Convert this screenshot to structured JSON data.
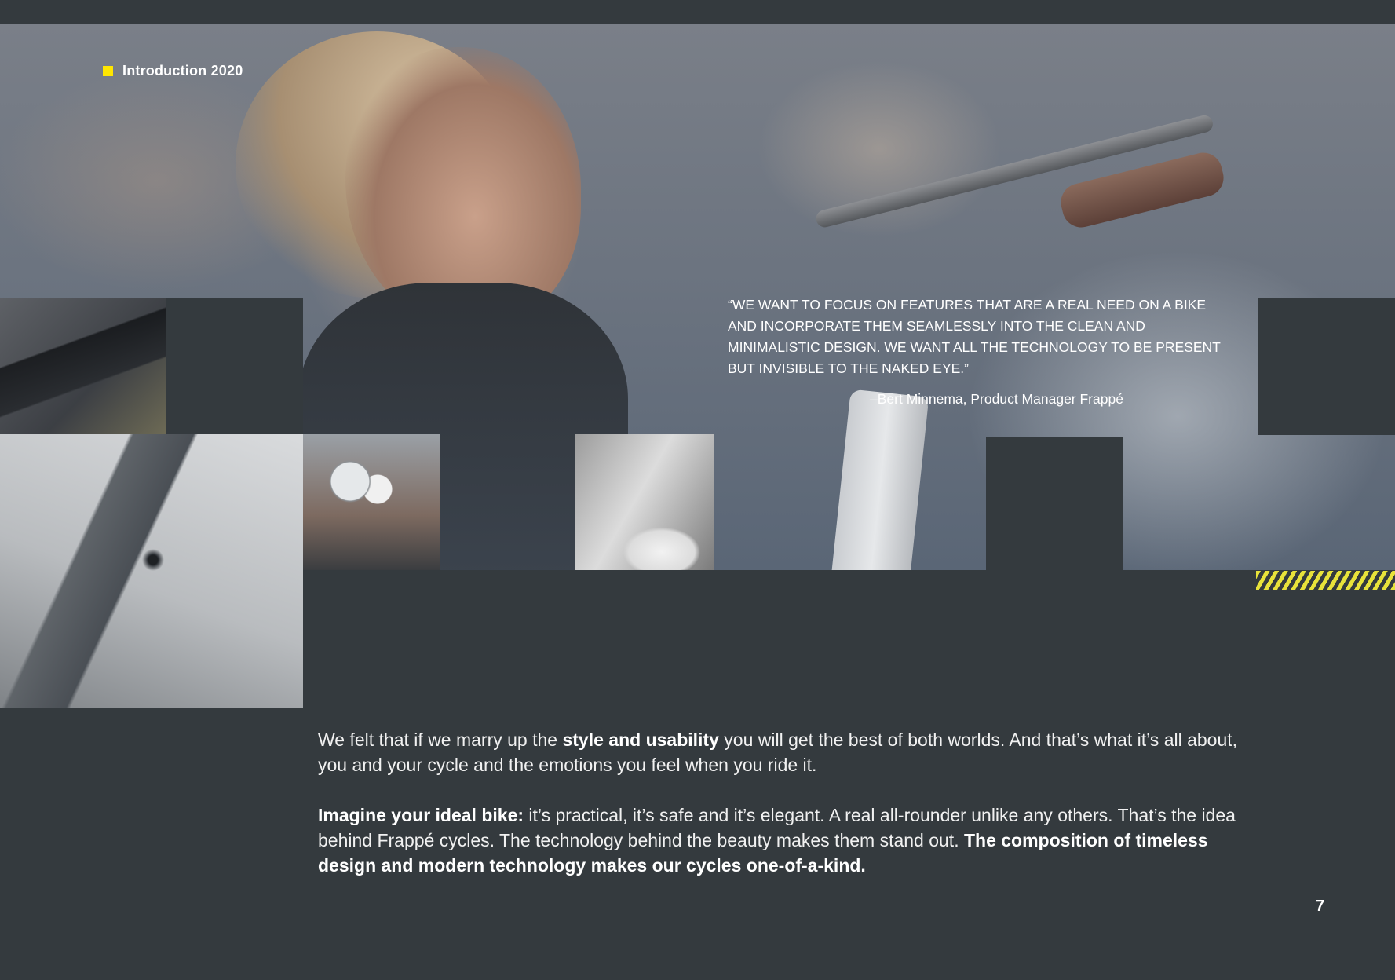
{
  "header": {
    "section_label": "Introduction 2020",
    "accent_color": "#ffe600"
  },
  "quote": {
    "text": "“WE WANT TO FOCUS ON FEATURES THAT ARE A REAL NEED ON A BIKE AND INCORPORATE THEM SEAMLESSLY INTO THE CLEAN AND MINIMALISTIC DESIGN. WE WANT ALL THE TECHNOLOGY TO BE PRESENT BUT INVISIBLE TO THE NAKED EYE.”",
    "attribution": "–Bert Minnema, Product Manager Frappé"
  },
  "body": {
    "p1_a": "We felt that if we marry up the ",
    "p1_b": "style and usability",
    "p1_c": " you will get the best of both worlds. And that’s what it’s all about, you and your cycle and the emotions you feel when you ride it.",
    "p2_a": "Imagine your ideal bike:",
    "p2_b": " it’s practical, it’s safe and it’s elegant. A real all-rounder unlike any others. That’s the idea behind Frappé cycles. The technology behind the beauty makes them stand out. ",
    "p2_c": "The composition of timeless design and modern technology makes our cycles one-of-a-kind."
  },
  "footer": {
    "page_number": "7"
  }
}
